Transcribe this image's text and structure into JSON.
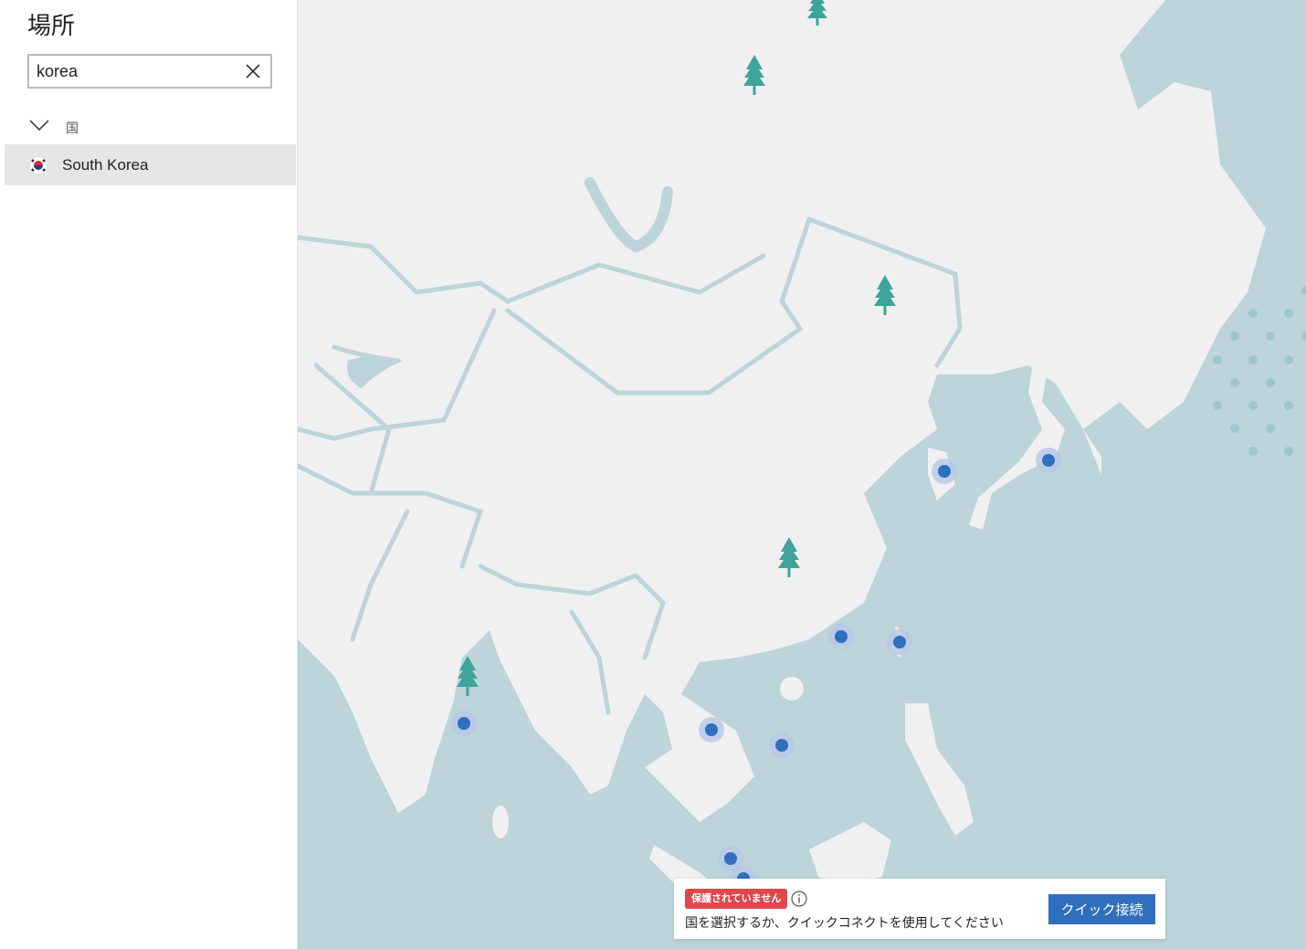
{
  "sidebar": {
    "title": "場所",
    "search": {
      "value": "korea",
      "clear_icon": "close-icon"
    },
    "group": {
      "label": "国",
      "icon": "chevron-down-icon"
    },
    "results": [
      {
        "label": "South Korea",
        "flag": "south-korea-flag"
      }
    ]
  },
  "map": {
    "colors": {
      "water": "#bcd4da",
      "land": "#f0f0f0",
      "pin": "#2f6fbe",
      "tree": "#3ea49b"
    }
  },
  "status": {
    "badge": "保護されていません",
    "message": "国を選択するか、クイックコネクトを使用してください",
    "info_icon": "info-icon",
    "quick_connect_label": "クイック接続"
  }
}
